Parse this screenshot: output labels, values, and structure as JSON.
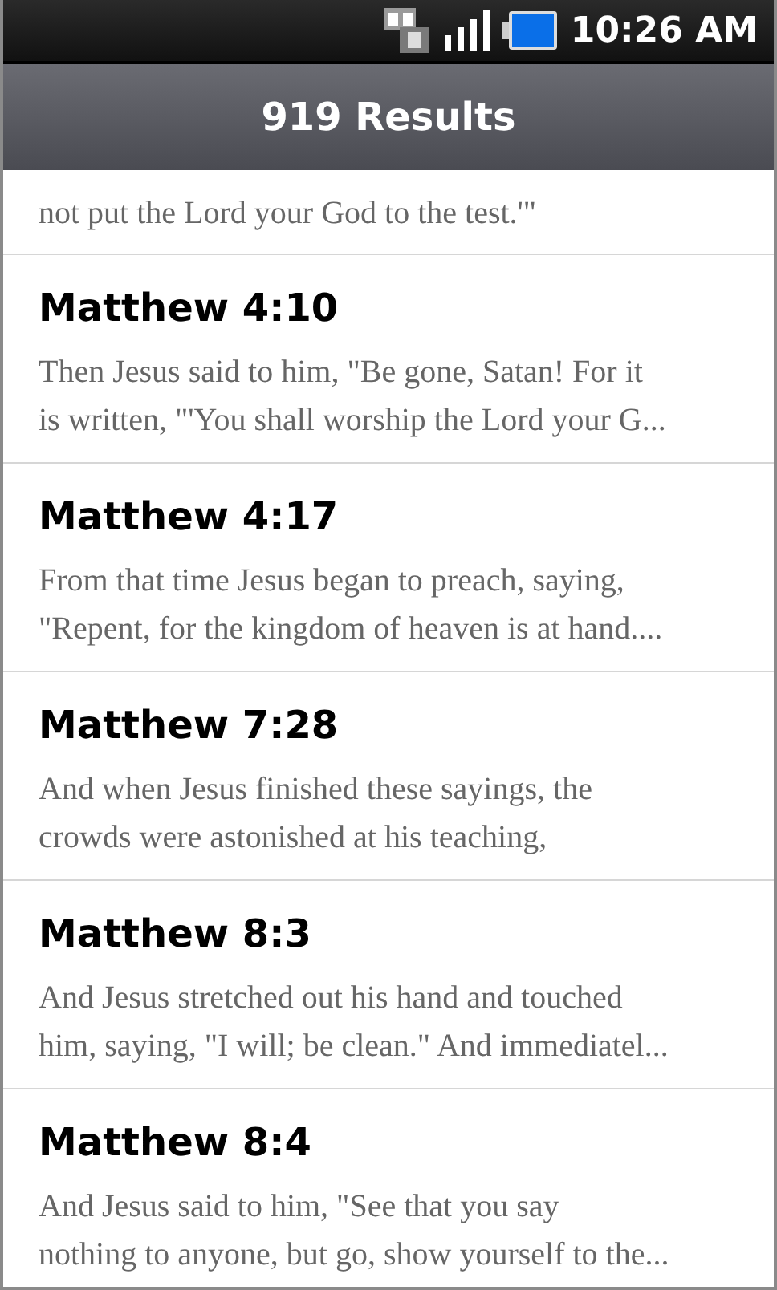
{
  "status_bar": {
    "time": "10:26 AM"
  },
  "header": {
    "title": "919 Results"
  },
  "partial_result": {
    "lines": [
      "not put the Lord your God to the test.'\""
    ]
  },
  "results": [
    {
      "reference": "Matthew 4:10",
      "lines": [
        "Then Jesus said to him, \"Be gone, Satan! For it",
        "is written, \"'You shall worship the Lord your G..."
      ]
    },
    {
      "reference": "Matthew 4:17",
      "lines": [
        "From that time Jesus began to preach, saying,",
        "\"Repent, for the kingdom of heaven is at hand...."
      ]
    },
    {
      "reference": "Matthew 7:28",
      "lines": [
        "And when Jesus finished these sayings, the",
        "crowds were astonished at his teaching,"
      ]
    },
    {
      "reference": "Matthew 8:3",
      "lines": [
        "And Jesus stretched out his hand and touched",
        "him, saying, \"I will; be clean.\" And immediatel..."
      ]
    },
    {
      "reference": "Matthew 8:4",
      "lines": [
        "And Jesus said to him, \"See that you say",
        "nothing to anyone, but go, show yourself to the..."
      ]
    }
  ]
}
